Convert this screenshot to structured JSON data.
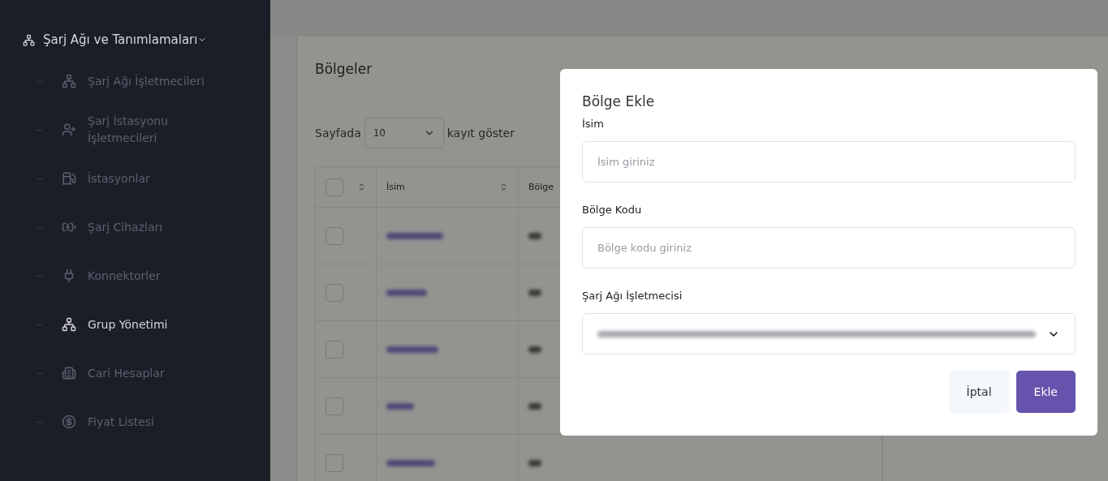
{
  "sidebar": {
    "header": {
      "label": "Şarj Ağı ve Tanımlamaları",
      "expanded": true
    },
    "items": [
      {
        "label": "Şarj Ağı İşletmecileri",
        "selected": false
      },
      {
        "label": "Şarj İstasyonu İşletmecileri",
        "selected": false
      },
      {
        "label": "İstasyonlar",
        "selected": false
      },
      {
        "label": "Şarj Cihazları",
        "selected": false
      },
      {
        "label": "Konnektorler",
        "selected": false
      },
      {
        "label": "Grup Yönetimi",
        "selected": true
      },
      {
        "label": "Cari Hesaplar",
        "selected": false
      },
      {
        "label": "Fiyat Listesi",
        "selected": false
      }
    ]
  },
  "page": {
    "title": "Bölgeler",
    "page_size": {
      "before": "Sayfada",
      "value": "10",
      "after": "kayıt göster"
    },
    "table": {
      "columns": [
        {
          "label": "İsim"
        },
        {
          "label": "Bölge"
        }
      ],
      "header_checked": false,
      "rows": [
        {
          "checked": false
        },
        {
          "checked": false
        },
        {
          "checked": false
        },
        {
          "checked": false
        },
        {
          "checked": false
        }
      ]
    }
  },
  "modal": {
    "title": "Bölge Ekle",
    "fields": [
      {
        "kind": "text",
        "label": "İsim",
        "placeholder": "İsim giriniz"
      },
      {
        "kind": "text",
        "label": "Bölge Kodu",
        "placeholder": "Bölge kodu giriniz"
      },
      {
        "kind": "select",
        "label": "Şarj Ağı İşletmecisi"
      }
    ],
    "buttons": [
      {
        "label": "İptal",
        "kind": "secondary"
      },
      {
        "label": "Ekle",
        "kind": "primary"
      }
    ]
  }
}
